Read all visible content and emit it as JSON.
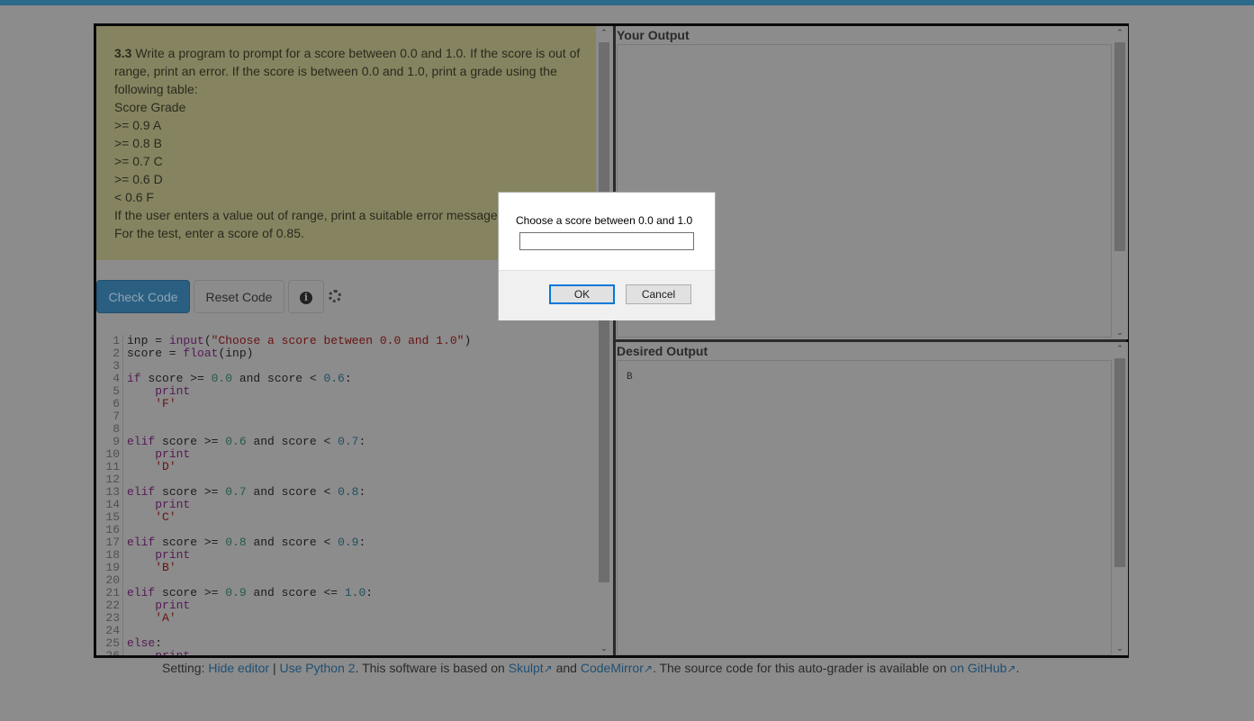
{
  "problem": {
    "number": "3.3",
    "intro": "Write a program to prompt for a score between 0.0 and 1.0. If the score is out of range, print an error. If the score is between 0.0 and 1.0, print a grade using the following table:",
    "table_header": "Score Grade",
    "table_rows": [
      ">= 0.9 A",
      ">= 0.8 B",
      ">= 0.7 C",
      ">= 0.6 D",
      "< 0.6 F"
    ],
    "note1": "If the user enters a value out of range, print a suitable error message and exit.",
    "note2": "For the test, enter a score of 0.85."
  },
  "toolbar": {
    "check_label": "Check Code",
    "reset_label": "Reset Code",
    "info_glyph": "i"
  },
  "code_lines": [
    [
      [
        "inp = ",
        ""
      ],
      [
        "input",
        "kw"
      ],
      [
        "(",
        ""
      ],
      [
        "\"Choose a score between 0.0 and 1.0\"",
        "st"
      ],
      [
        ")",
        ""
      ]
    ],
    [
      [
        "score = ",
        ""
      ],
      [
        "float",
        "kw"
      ],
      [
        "(inp)",
        ""
      ]
    ],
    [],
    [
      [
        "if",
        "kw"
      ],
      [
        " score >= ",
        ""
      ],
      [
        "0.0",
        "nu"
      ],
      [
        " and score < ",
        ""
      ],
      [
        "0.6",
        "nu2"
      ],
      [
        ":",
        ""
      ]
    ],
    [
      [
        "    ",
        ""
      ],
      [
        "print",
        "kw"
      ]
    ],
    [
      [
        "    ",
        ""
      ],
      [
        "'F'",
        "st"
      ]
    ],
    [],
    [],
    [
      [
        "elif",
        "kw"
      ],
      [
        " score >= ",
        ""
      ],
      [
        "0.6",
        "nu"
      ],
      [
        " and score < ",
        ""
      ],
      [
        "0.7",
        "nu2"
      ],
      [
        ":",
        ""
      ]
    ],
    [
      [
        "    ",
        ""
      ],
      [
        "print",
        "kw"
      ]
    ],
    [
      [
        "    ",
        ""
      ],
      [
        "'D'",
        "st"
      ]
    ],
    [],
    [
      [
        "elif",
        "kw"
      ],
      [
        " score >= ",
        ""
      ],
      [
        "0.7",
        "nu"
      ],
      [
        " and score < ",
        ""
      ],
      [
        "0.8",
        "nu2"
      ],
      [
        ":",
        ""
      ]
    ],
    [
      [
        "    ",
        ""
      ],
      [
        "print",
        "kw"
      ]
    ],
    [
      [
        "    ",
        ""
      ],
      [
        "'C'",
        "st"
      ]
    ],
    [],
    [
      [
        "elif",
        "kw"
      ],
      [
        " score >= ",
        ""
      ],
      [
        "0.8",
        "nu"
      ],
      [
        " and score < ",
        ""
      ],
      [
        "0.9",
        "nu2"
      ],
      [
        ":",
        ""
      ]
    ],
    [
      [
        "    ",
        ""
      ],
      [
        "print",
        "kw"
      ]
    ],
    [
      [
        "    ",
        ""
      ],
      [
        "'B'",
        "st"
      ]
    ],
    [],
    [
      [
        "elif",
        "kw"
      ],
      [
        " score >= ",
        ""
      ],
      [
        "0.9",
        "nu"
      ],
      [
        " and score <= ",
        ""
      ],
      [
        "1.0",
        "nu2"
      ],
      [
        ":",
        ""
      ]
    ],
    [
      [
        "    ",
        ""
      ],
      [
        "print",
        "kw"
      ]
    ],
    [
      [
        "    ",
        ""
      ],
      [
        "'A'",
        "st"
      ]
    ],
    [],
    [
      [
        "else",
        "kw"
      ],
      [
        ":",
        ""
      ]
    ],
    [
      [
        "    ",
        ""
      ],
      [
        "print",
        "kw"
      ]
    ]
  ],
  "your_output": {
    "title": "Your Output",
    "content": ""
  },
  "desired_output": {
    "title": "Desired Output",
    "content": "B"
  },
  "footer": {
    "setting": "Setting:",
    "hide_editor": "Hide editor",
    "sep": "|",
    "use_python2": "Use Python 2",
    "text1": ". This software is based on",
    "skulpt": "Skulpt",
    "and": "and",
    "codemirror": "CodeMirror",
    "text2": ". The source code for this auto-grader is available on",
    "github": "on GitHub",
    "end": "."
  },
  "dialog": {
    "message": "Choose a score between 0.0 and 1.0",
    "input_value": "",
    "ok": "OK",
    "cancel": "Cancel"
  },
  "colors": {
    "accent": "#2c6a8c",
    "problem_bg": "#868460",
    "ok_border": "#0078d7"
  }
}
